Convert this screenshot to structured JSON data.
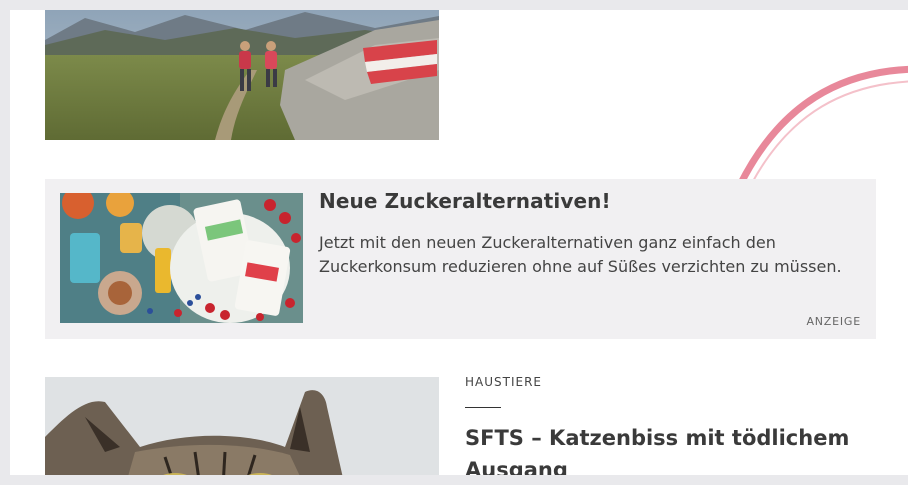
{
  "ad": {
    "title": "Neue Zuckeralternativen!",
    "description": "Jetzt mit den neuen Zuckeralternativen ganz einfach den Zuckerkonsum reduzieren ohne auf Süßes verzichten zu müssen.",
    "label": "ANZEIGE"
  },
  "article": {
    "category": "HAUSTIERE",
    "title": "SFTS – Katzenbiss mit tödlichem Ausgang"
  },
  "colors": {
    "arrow": "#e8889a",
    "card_bg": "#f1f0f2",
    "text_dark": "#3a3a3a"
  }
}
